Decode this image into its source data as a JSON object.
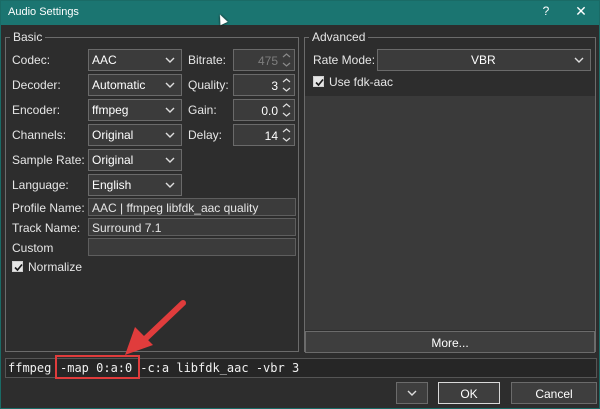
{
  "window": {
    "title": "Audio Settings",
    "help_glyph": "?",
    "close_glyph": "✕"
  },
  "basic": {
    "legend": "Basic",
    "codec": {
      "label": "Codec:",
      "value": "AAC"
    },
    "decoder": {
      "label": "Decoder:",
      "value": "Automatic"
    },
    "encoder": {
      "label": "Encoder:",
      "value": "ffmpeg"
    },
    "channels": {
      "label": "Channels:",
      "value": "Original"
    },
    "sample_rate": {
      "label": "Sample Rate:",
      "value": "Original"
    },
    "language": {
      "label": "Language:",
      "value": "English"
    },
    "bitrate": {
      "label": "Bitrate:",
      "value": "475",
      "disabled": true
    },
    "quality": {
      "label": "Quality:",
      "value": "3"
    },
    "gain": {
      "label": "Gain:",
      "value": "0.0"
    },
    "delay": {
      "label": "Delay:",
      "value": "14"
    },
    "profile_name": {
      "label": "Profile Name:",
      "value": "AAC | ffmpeg libfdk_aac quality"
    },
    "track_name": {
      "label": "Track Name:",
      "value": "Surround 7.1"
    },
    "custom": {
      "label": "Custom",
      "value": ""
    },
    "normalize": {
      "label": "Normalize",
      "checked": true
    }
  },
  "advanced": {
    "legend": "Advanced",
    "rate_mode": {
      "label": "Rate Mode:",
      "value": "VBR"
    },
    "use_fdk": {
      "label": "Use fdk-aac",
      "checked": true
    },
    "more_button": "More..."
  },
  "command_line": {
    "before": "ffmpeg ",
    "highlighted": "-map 0:a:0",
    "after": " -c:a libfdk_aac -vbr 3"
  },
  "footer": {
    "ok": "OK",
    "cancel": "Cancel"
  },
  "colors": {
    "titlebar": "#1b7571",
    "background": "#2d2d2d",
    "annotation": "#e03c3c"
  }
}
